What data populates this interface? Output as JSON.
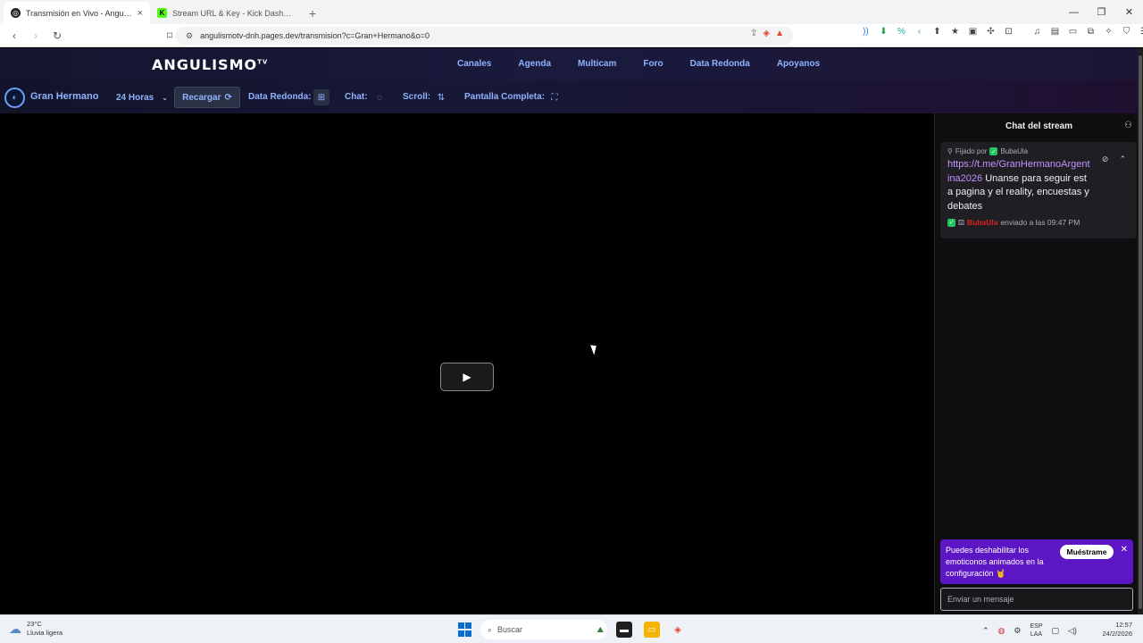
{
  "browser": {
    "tabs": [
      {
        "title": "Transmisión en Vivo - Angulismo",
        "active": true
      },
      {
        "title": "Stream URL & Key - Kick Dashboard",
        "active": false
      }
    ],
    "url": "angulismotv-dnh.pages.dev/transmision?c=Gran+Hermano&o=0"
  },
  "site": {
    "logo": "ANGULISMO",
    "logo_suffix": "TV",
    "nav": [
      "Canales",
      "Agenda",
      "Multicam",
      "Foro",
      "Data Redonda",
      "Apoyanos"
    ]
  },
  "toolbar": {
    "channel": "Gran Hermano",
    "hours": "24 Horas",
    "reload": "Recargar",
    "data_redonda": "Data Redonda:",
    "chat": "Chat:",
    "scroll": "Scroll:",
    "fullscreen": "Pantalla Completa:"
  },
  "chat": {
    "header": "Chat del stream",
    "pinned_by_label": "Fijado por",
    "pinned_user": "BubaUla",
    "pinned_link": "https://t.me/GranHermanoArgentina2026",
    "pinned_text": " Unanse para seguir esta pagina y el reality, encuestas y debates",
    "pinned_meta_user": "BubaUla",
    "pinned_meta_text": "enviado a las 09:47 PM",
    "notice_text": "Puedes deshabilitar los emoticonos animados en la configuración 🤘",
    "notice_button": "Muéstrame",
    "input_placeholder": "Enviar un mensaje"
  },
  "taskbar": {
    "temp": "23°C",
    "weather": "Lluvia ligera",
    "search": "Buscar",
    "lang1": "ESP",
    "lang2": "LAA",
    "time": "12:57",
    "date": "24/2/2026"
  },
  "colors": {
    "accent_link": "#8fb3ff",
    "pinned_link": "#bf94ff",
    "notice_bg": "#5c16c5"
  }
}
